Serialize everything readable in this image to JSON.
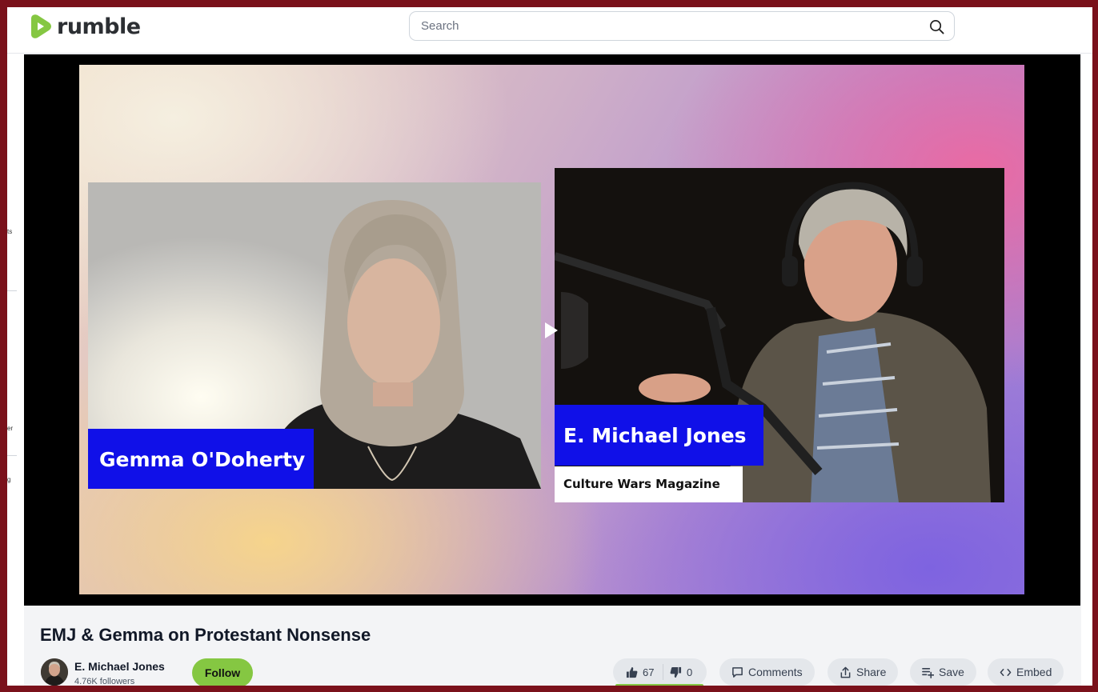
{
  "header": {
    "brand": "rumble",
    "search_placeholder": "Search"
  },
  "sidebar_fragments": [
    "ts",
    "er",
    "g"
  ],
  "video": {
    "guest_left_name": "Gemma O'Doherty",
    "guest_right_name": "E. Michael Jones",
    "guest_right_affiliation": "Culture Wars Magazine"
  },
  "info": {
    "title": "EMJ & Gemma on Protestant Nonsense",
    "channel": "E. Michael Jones",
    "followers": "4.76K followers",
    "follow_label": "Follow",
    "likes": "67",
    "dislikes": "0",
    "like_ratio": 1.0,
    "actions": {
      "comments": "Comments",
      "share": "Share",
      "save": "Save",
      "embed": "Embed"
    }
  },
  "colors": {
    "brand_green": "#85c742",
    "nameplate_blue": "#1010e8",
    "frame_border": "#7a111b"
  }
}
